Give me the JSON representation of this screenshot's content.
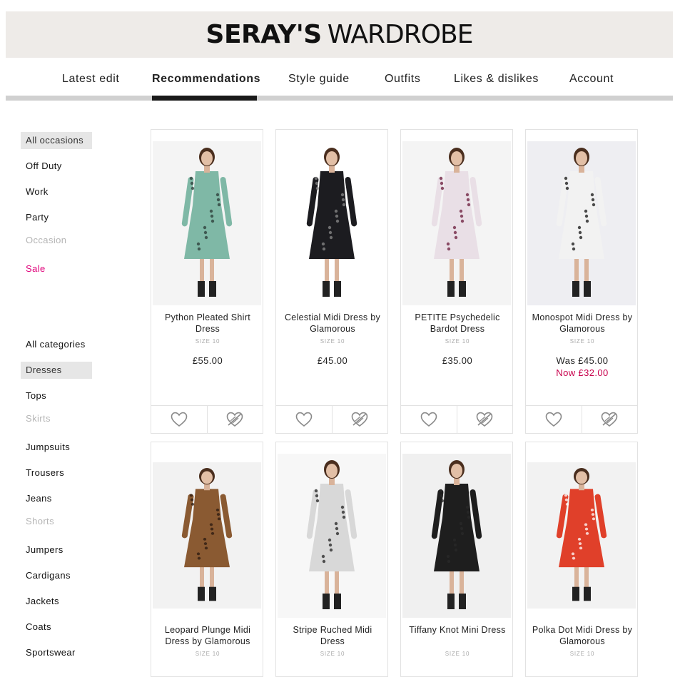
{
  "brand": {
    "bold": "SERAY'S",
    "light": "WARDROBE"
  },
  "nav": {
    "items": [
      "Latest edit",
      "Recommendations",
      "Style guide",
      "Outfits",
      "Likes & dislikes",
      "Account"
    ],
    "active_index": 1
  },
  "sidebar": {
    "occasions": [
      {
        "label": "All occasions",
        "state": "selected"
      },
      {
        "label": "Off Duty",
        "state": "normal"
      },
      {
        "label": "Work",
        "state": "normal"
      },
      {
        "label": "Party",
        "state": "normal"
      },
      {
        "label": "Occasion",
        "state": "disabled"
      },
      {
        "label": "Sale",
        "state": "sale"
      }
    ],
    "categories": [
      {
        "label": "All categories",
        "state": "normal"
      },
      {
        "label": "Dresses",
        "state": "selected"
      },
      {
        "label": "Tops",
        "state": "normal"
      },
      {
        "label": "Skirts",
        "state": "disabled"
      },
      {
        "label": "Jumpsuits",
        "state": "normal"
      },
      {
        "label": "Trousers",
        "state": "normal"
      },
      {
        "label": "Jeans",
        "state": "normal"
      },
      {
        "label": "Shorts",
        "state": "disabled"
      },
      {
        "label": "Jumpers",
        "state": "normal"
      },
      {
        "label": "Cardigans",
        "state": "normal"
      },
      {
        "label": "Jackets",
        "state": "normal"
      },
      {
        "label": "Coats",
        "state": "normal"
      },
      {
        "label": "Sportswear",
        "state": "normal"
      }
    ]
  },
  "products": [
    {
      "name": "Python Pleated Shirt Dress",
      "size": "SIZE 10",
      "price": "£55.00",
      "sale_price": "",
      "dress_color": "#7fb8a6",
      "pattern": "#2a3a35",
      "bg": "#f4f4f4"
    },
    {
      "name": "Celestial Midi Dress by Glamorous",
      "size": "SIZE 10",
      "price": "£45.00",
      "sale_price": "",
      "dress_color": "#1c1c20",
      "pattern": "#8a8a8a",
      "bg": "#ffffff"
    },
    {
      "name": "PETITE Psychedelic Bardot Dress",
      "size": "SIZE 10",
      "price": "£35.00",
      "sale_price": "",
      "dress_color": "#e9dfe6",
      "pattern": "#6a1a3a",
      "bg": "#f4f4f4"
    },
    {
      "name": "Monospot Midi Dress by Glamorous",
      "size": "SIZE 10",
      "price": "Was £45.00",
      "sale_price": "Now £32.00",
      "dress_color": "#f2f2f2",
      "pattern": "#111111",
      "bg": "#eeeef2"
    },
    {
      "name": "Leopard Plunge Midi Dress by Glamorous",
      "size": "SIZE 10",
      "price": "",
      "sale_price": "",
      "dress_color": "#8a5a32",
      "pattern": "#2a1a10",
      "bg": "#f2f2f2"
    },
    {
      "name": "Stripe Ruched Midi Dress",
      "size": "SIZE 10",
      "price": "",
      "sale_price": "",
      "dress_color": "#d8d8d8",
      "pattern": "#222222",
      "bg": "#f7f7f7"
    },
    {
      "name": "Tiffany Knot Mini Dress",
      "size": "SIZE 10",
      "price": "",
      "sale_price": "",
      "dress_color": "#1e1e1e",
      "pattern": "#2a2a2a",
      "bg": "#f0f0f0"
    },
    {
      "name": "Polka Dot Midi Dress by Glamorous",
      "size": "SIZE 10",
      "price": "",
      "sale_price": "",
      "dress_color": "#e0402a",
      "pattern": "#ffffff",
      "bg": "#f2f2f2"
    }
  ],
  "icons": {
    "like": "heart-outline-icon",
    "dislike": "heart-crossed-icon"
  },
  "colors": {
    "sale_pink": "#e0007a",
    "now_price": "#c8004c",
    "banner_bg": "#eeebe8"
  }
}
